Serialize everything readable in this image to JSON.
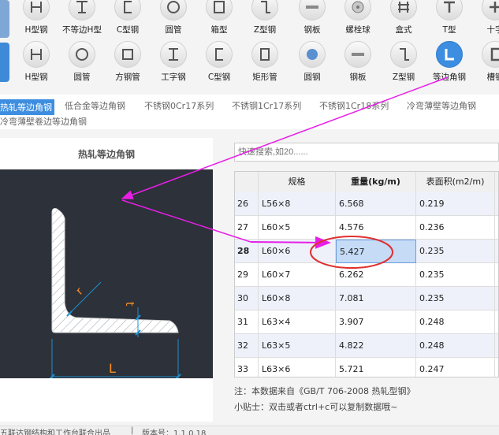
{
  "icon_row_1": [
    {
      "label": "H型钢",
      "icon": "h-beam-icon"
    },
    {
      "label": "不等边H型",
      "icon": "t-beam-icon"
    },
    {
      "label": "C型钢",
      "icon": "c-channel-icon"
    },
    {
      "label": "圆管",
      "icon": "round-tube-icon"
    },
    {
      "label": "箱型",
      "icon": "box-section-icon"
    },
    {
      "label": "Z型钢",
      "icon": "z-section-icon"
    },
    {
      "label": "钢板",
      "icon": "steel-plate-icon"
    },
    {
      "label": "螺栓球",
      "icon": "bolt-ball-icon"
    },
    {
      "label": "盒式",
      "icon": "box-type-icon"
    },
    {
      "label": "T型",
      "icon": "t-section-icon"
    },
    {
      "label": "十字",
      "icon": "cross-section-icon"
    }
  ],
  "icon_row_2": [
    {
      "label": "H型钢",
      "icon": "h-beam-icon"
    },
    {
      "label": "圆管",
      "icon": "round-tube-icon"
    },
    {
      "label": "方钢管",
      "icon": "square-tube-icon"
    },
    {
      "label": "工字钢",
      "icon": "i-beam-icon"
    },
    {
      "label": "C型钢",
      "icon": "c-channel-icon"
    },
    {
      "label": "矩形管",
      "icon": "rect-tube-icon"
    },
    {
      "label": "圆钢",
      "icon": "round-bar-icon"
    },
    {
      "label": "钢板",
      "icon": "steel-plate-icon"
    },
    {
      "label": "Z型钢",
      "icon": "z-section-icon"
    },
    {
      "label": "等边角钢",
      "icon": "equal-angle-icon",
      "active": true
    },
    {
      "label": "槽钢",
      "icon": "channel-icon"
    }
  ],
  "categories": [
    {
      "label": "热轧等边角钢",
      "active": true
    },
    {
      "label": "低合金等边角钢"
    },
    {
      "label": "不锈钢0Cr17系列"
    },
    {
      "label": "不锈钢1Cr17系列"
    },
    {
      "label": "不锈钢1Cr18系列"
    },
    {
      "label": "冷弯薄壁等边角钢"
    },
    {
      "label": "冷弯薄壁卷边等边角钢"
    }
  ],
  "left_panel": {
    "title": "热轧等边角钢",
    "diagram_labels": {
      "r": "r",
      "t": "t",
      "L": "L"
    }
  },
  "search": {
    "placeholder": "快速搜索,如20......"
  },
  "table": {
    "headers": [
      "规格",
      "重量(kg/m)",
      "表面积(m2/m)"
    ],
    "rows": [
      {
        "idx": "26",
        "spec": "L56×8",
        "weight": "6.568",
        "area": "0.219",
        "more": ""
      },
      {
        "idx": "27",
        "spec": "L60×5",
        "weight": "4.576",
        "area": "0.236",
        "more": "("
      },
      {
        "idx": "28",
        "spec": "L60×6",
        "weight": "5.427",
        "area": "0.235",
        "more": "6",
        "selected": true
      },
      {
        "idx": "29",
        "spec": "L60×7",
        "weight": "6.262",
        "area": "0.235",
        "more": "7"
      },
      {
        "idx": "30",
        "spec": "L60×8",
        "weight": "7.081",
        "area": "0.235",
        "more": "8"
      },
      {
        "idx": "31",
        "spec": "L63×4",
        "weight": "3.907",
        "area": "0.248",
        "more": "("
      },
      {
        "idx": "32",
        "spec": "L63×5",
        "weight": "4.822",
        "area": "0.248",
        "more": "("
      },
      {
        "idx": "33",
        "spec": "L63×6",
        "weight": "5.721",
        "area": "0.247",
        "more": ""
      }
    ]
  },
  "note": "注：本数据来自《GB/T 706-2008 热轧型钢》",
  "tip": "小贴士：双击或者ctrl+c可以复制数据哦~",
  "status": {
    "left": "五联达钢结构和工作台联合出品",
    "version": "版本号：1.1.0.18"
  },
  "colors": {
    "accent": "#3d8ee0",
    "annotation": "#e81ee8",
    "highlight_circle": "#e03030"
  }
}
